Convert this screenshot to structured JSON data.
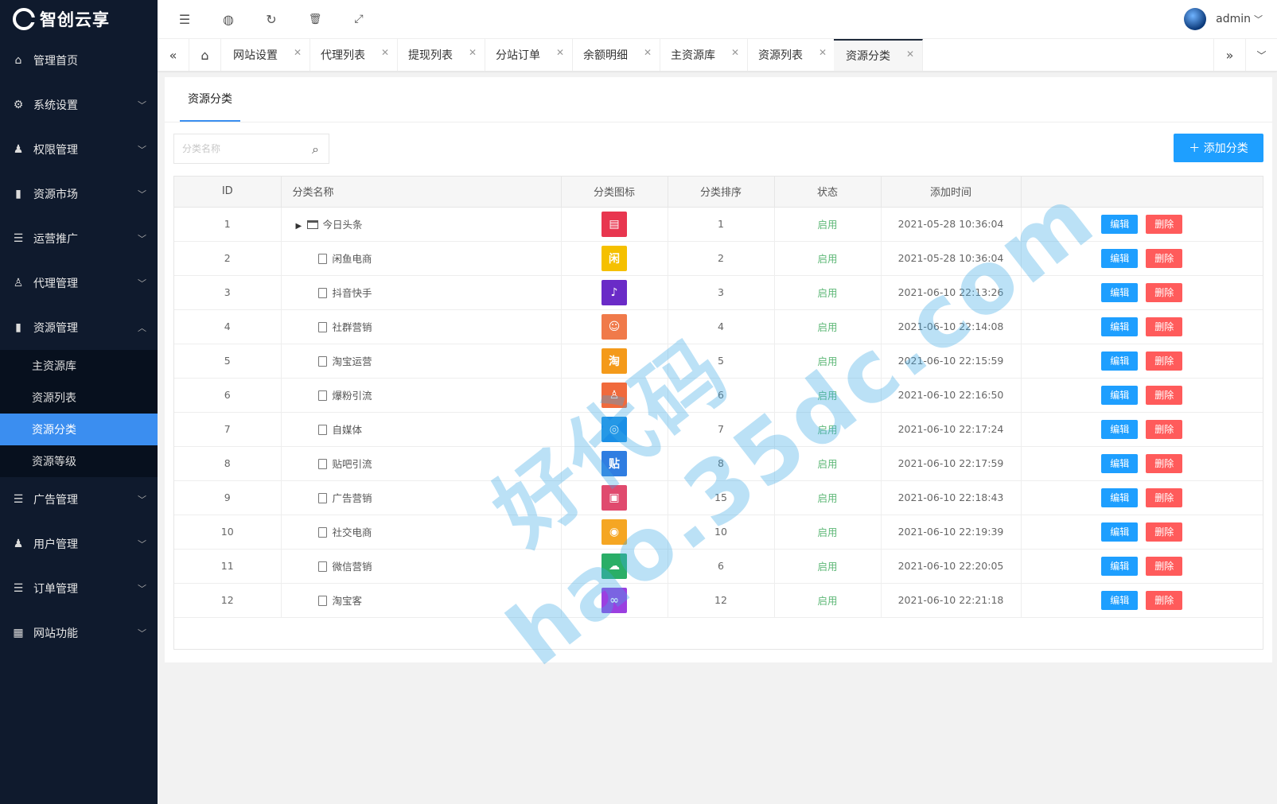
{
  "brand": {
    "name": "智创云享"
  },
  "sidebar": {
    "items": [
      {
        "label": "管理首页",
        "icon": "home-icon",
        "glyph": "⌂",
        "expandable": false
      },
      {
        "label": "系统设置",
        "icon": "gear-icon",
        "glyph": "⚙",
        "expandable": true
      },
      {
        "label": "权限管理",
        "icon": "users-icon",
        "glyph": "♟",
        "expandable": true
      },
      {
        "label": "资源市场",
        "icon": "bookmark-icon",
        "glyph": "▮",
        "expandable": true
      },
      {
        "label": "运营推广",
        "icon": "list-icon",
        "glyph": "☰",
        "expandable": true
      },
      {
        "label": "代理管理",
        "icon": "person-icon",
        "glyph": "♙",
        "expandable": true
      },
      {
        "label": "资源管理",
        "icon": "bookmark-icon",
        "glyph": "▮",
        "expandable": true,
        "expanded": true
      }
    ],
    "submenu": [
      {
        "label": "主资源库"
      },
      {
        "label": "资源列表"
      },
      {
        "label": "资源分类",
        "active": true
      },
      {
        "label": "资源等级"
      }
    ],
    "items_after": [
      {
        "label": "广告管理",
        "icon": "list-icon",
        "glyph": "☰"
      },
      {
        "label": "用户管理",
        "icon": "user-icon",
        "glyph": "♟"
      },
      {
        "label": "订单管理",
        "icon": "list-icon",
        "glyph": "☰"
      },
      {
        "label": "网站功能",
        "icon": "grid-icon",
        "glyph": "▦"
      }
    ]
  },
  "header": {
    "username": "admin"
  },
  "tabs": [
    {
      "label": "网站设置"
    },
    {
      "label": "代理列表"
    },
    {
      "label": "提现列表"
    },
    {
      "label": "分站订单"
    },
    {
      "label": "余额明细"
    },
    {
      "label": "主资源库"
    },
    {
      "label": "资源列表"
    },
    {
      "label": "资源分类",
      "active": true
    }
  ],
  "main": {
    "card_tab": "资源分类",
    "search_placeholder": "分类名称",
    "add_button": "＋ 添加分类",
    "table": {
      "columns": [
        "ID",
        "分类名称",
        "分类图标",
        "分类排序",
        "状态",
        "添加时间",
        ""
      ],
      "edit_label": "编辑",
      "delete_label": "删除",
      "rows": [
        {
          "id": "1",
          "name": "今日头条",
          "parent": true,
          "sort": "1",
          "status": "启用",
          "time": "2021-05-28 10:36:04",
          "icon_color": "#e8364f",
          "icon_glyph": "▤"
        },
        {
          "id": "2",
          "name": "闲鱼电商",
          "parent": false,
          "sort": "2",
          "status": "启用",
          "time": "2021-05-28 10:36:04",
          "icon_color": "#f5c000",
          "icon_glyph": "闲"
        },
        {
          "id": "3",
          "name": "抖音快手",
          "parent": false,
          "sort": "3",
          "status": "启用",
          "time": "2021-06-10 22:13:26",
          "icon_color": "#6a2bc7",
          "icon_glyph": "♪"
        },
        {
          "id": "4",
          "name": "社群营销",
          "parent": false,
          "sort": "4",
          "status": "启用",
          "time": "2021-06-10 22:14:08",
          "icon_color": "#f07a4a",
          "icon_glyph": "☺"
        },
        {
          "id": "5",
          "name": "淘宝运营",
          "parent": false,
          "sort": "5",
          "status": "启用",
          "time": "2021-06-10 22:15:59",
          "icon_color": "#f49a1a",
          "icon_glyph": "淘"
        },
        {
          "id": "6",
          "name": "爆粉引流",
          "parent": false,
          "sort": "6",
          "status": "启用",
          "time": "2021-06-10 22:16:50",
          "icon_color": "#f06a3c",
          "icon_glyph": "♙"
        },
        {
          "id": "7",
          "name": "自媒体",
          "parent": false,
          "sort": "7",
          "status": "启用",
          "time": "2021-06-10 22:17:24",
          "icon_color": "#1a8fe6",
          "icon_glyph": "◎"
        },
        {
          "id": "8",
          "name": "贴吧引流",
          "parent": false,
          "sort": "8",
          "status": "启用",
          "time": "2021-06-10 22:17:59",
          "icon_color": "#2f7de1",
          "icon_glyph": "贴"
        },
        {
          "id": "9",
          "name": "广告营销",
          "parent": false,
          "sort": "15",
          "status": "启用",
          "time": "2021-06-10 22:18:43",
          "icon_color": "#e04a6e",
          "icon_glyph": "▣"
        },
        {
          "id": "10",
          "name": "社交电商",
          "parent": false,
          "sort": "10",
          "status": "启用",
          "time": "2021-06-10 22:19:39",
          "icon_color": "#f5a623",
          "icon_glyph": "◉"
        },
        {
          "id": "11",
          "name": "微信营销",
          "parent": false,
          "sort": "6",
          "status": "启用",
          "time": "2021-06-10 22:20:05",
          "icon_color": "#2aae67",
          "icon_glyph": "☁"
        },
        {
          "id": "12",
          "name": "淘宝客",
          "parent": false,
          "sort": "12",
          "status": "启用",
          "time": "2021-06-10 22:21:18",
          "icon_color": "#9b3fe0",
          "icon_glyph": "∞"
        }
      ]
    }
  },
  "watermark": {
    "line1": "好代码",
    "line2": "hao.35dc.com"
  }
}
